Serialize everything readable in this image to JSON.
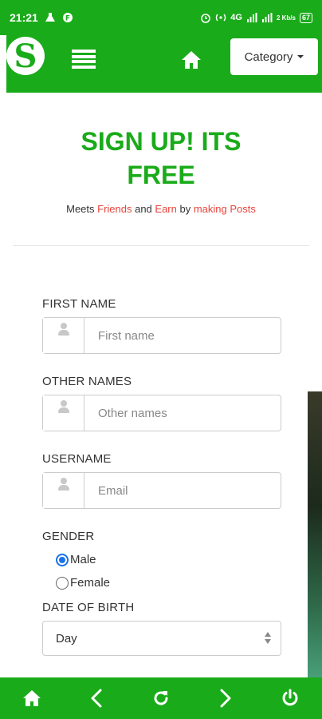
{
  "status_bar": {
    "time": "21:21",
    "network_label": "4G",
    "speed_label": "2 Kb/s",
    "battery": "67"
  },
  "navbar": {
    "logo_letter": "S",
    "category_label": "Category"
  },
  "header": {
    "title": "SIGN UP! ITS FREE",
    "subtitle_parts": {
      "p1": "Meets ",
      "p2": "Friends",
      "p3": " and ",
      "p4": "Earn",
      "p5": " by ",
      "p6": "making Posts"
    }
  },
  "form": {
    "first_name": {
      "label": "FIRST NAME",
      "placeholder": "First name"
    },
    "other_names": {
      "label": "OTHER NAMES",
      "placeholder": "Other names"
    },
    "username": {
      "label": "USERNAME",
      "placeholder": "Email"
    },
    "gender": {
      "label": "GENDER",
      "options": [
        "Male",
        "Female"
      ],
      "selected": "Male"
    },
    "dob": {
      "label": "DATE OF BIRTH",
      "day_value": "Day"
    }
  },
  "colors": {
    "brand_green": "#1aab1a",
    "accent_red": "#e8453c",
    "radio_blue": "#1a73e8"
  },
  "icons": {
    "bottom": [
      "home-icon",
      "back-icon",
      "refresh-icon",
      "forward-icon",
      "power-icon"
    ]
  }
}
